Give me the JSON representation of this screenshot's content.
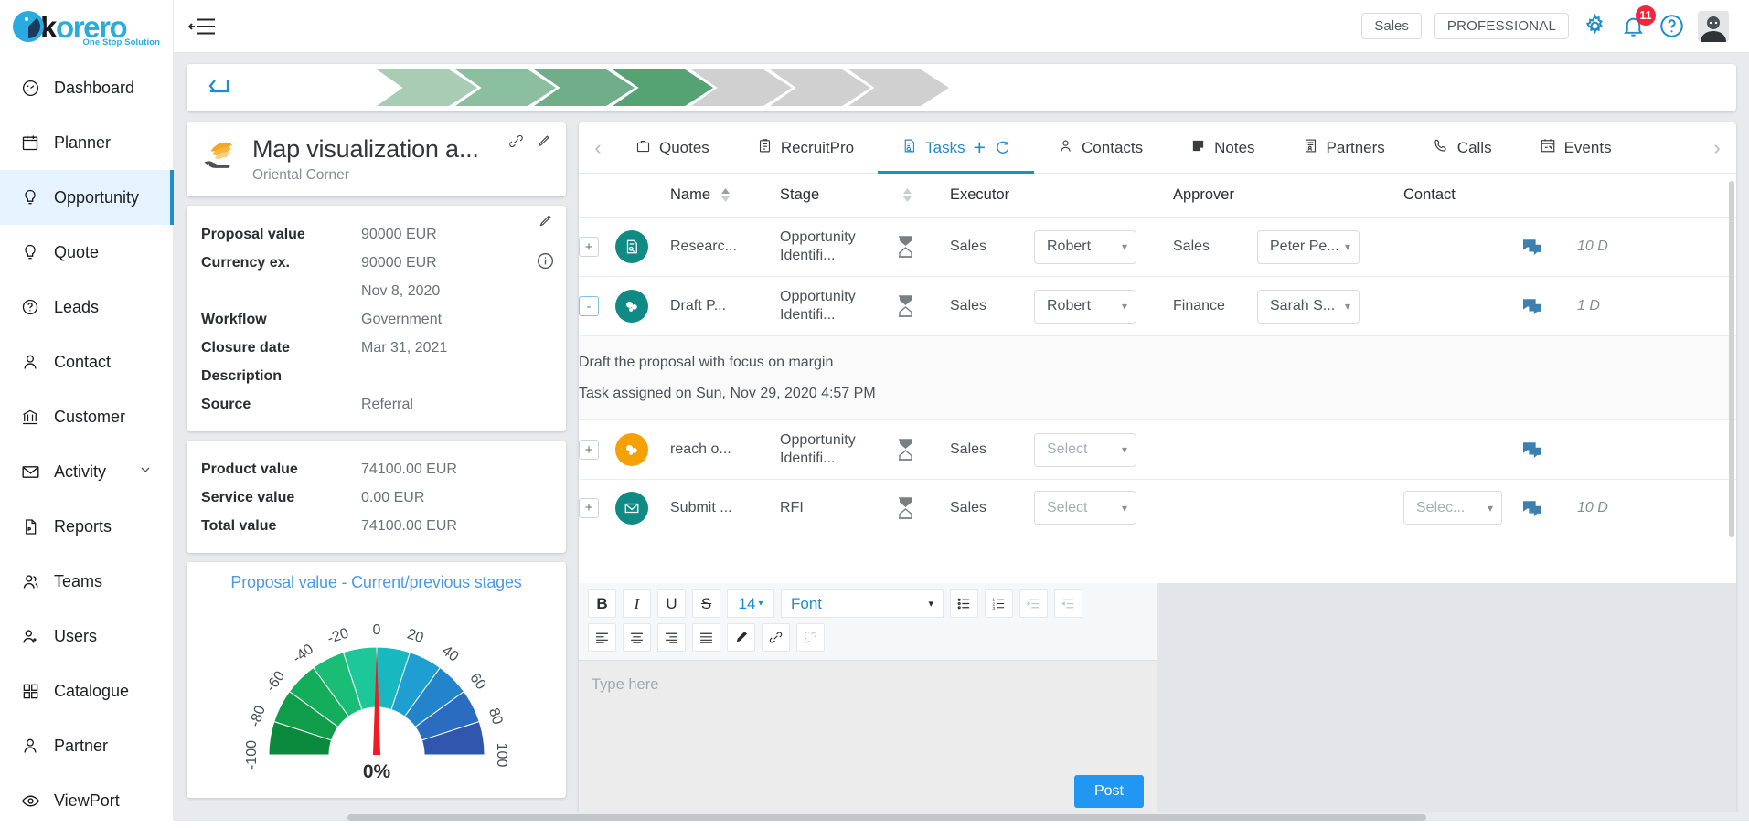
{
  "brand": {
    "name_k": "k",
    "name_rest": "orero",
    "tagline": "One Stop Solution",
    "logo_icon": "korero-logo-icon",
    "accent": "#29abe2"
  },
  "sidebar": {
    "items": [
      {
        "label": "Dashboard",
        "icon": "dashboard-icon",
        "active": false,
        "chevron": false
      },
      {
        "label": "Planner",
        "icon": "calendar-icon",
        "active": false,
        "chevron": false
      },
      {
        "label": "Opportunity",
        "icon": "bulb-icon",
        "active": true,
        "chevron": false
      },
      {
        "label": "Quote",
        "icon": "bulb-icon",
        "active": false,
        "chevron": false
      },
      {
        "label": "Leads",
        "icon": "question-circle-icon",
        "active": false,
        "chevron": false
      },
      {
        "label": "Contact",
        "icon": "user-icon",
        "active": false,
        "chevron": false
      },
      {
        "label": "Customer",
        "icon": "bank-icon",
        "active": false,
        "chevron": false
      },
      {
        "label": "Activity",
        "icon": "envelope-icon",
        "active": false,
        "chevron": true
      },
      {
        "label": "Reports",
        "icon": "pdf-file-icon",
        "active": false,
        "chevron": false
      },
      {
        "label": "Teams",
        "icon": "users-icon",
        "active": false,
        "chevron": false
      },
      {
        "label": "Users",
        "icon": "user-add-icon",
        "active": false,
        "chevron": false
      },
      {
        "label": "Catalogue",
        "icon": "grid-icon",
        "active": false,
        "chevron": false
      },
      {
        "label": "Partner",
        "icon": "user-icon",
        "active": false,
        "chevron": false
      },
      {
        "label": "ViewPort",
        "icon": "eye-icon",
        "active": false,
        "chevron": false
      }
    ]
  },
  "topbar": {
    "menu_icon": "collapse-menu-icon",
    "role_pill": "Sales",
    "plan_pill": "PROFESSIONAL",
    "settings_icon": "gear-icon",
    "notifications_icon": "bell-icon",
    "notifications_count": "11",
    "help_icon": "question-circle-icon",
    "avatar": "user-avatar",
    "badge_color": "#f4243c"
  },
  "stage_strip": {
    "back_icon": "back-arrow-icon",
    "stages": [
      {
        "state": "done",
        "color": "#a8cdb4"
      },
      {
        "state": "done",
        "color": "#8cbf9f"
      },
      {
        "state": "done",
        "color": "#6fae88"
      },
      {
        "state": "current",
        "color": "#55a273"
      },
      {
        "state": "todo",
        "color": "#d0d0d0"
      },
      {
        "state": "todo",
        "color": "#d0d0d0"
      },
      {
        "state": "todo",
        "color": "#d0d0d0"
      }
    ]
  },
  "opportunity": {
    "icon": "hand-money-icon",
    "title": "Map visualization a...",
    "subtitle": "Oriental Corner",
    "link_icon": "link-icon",
    "edit_icon": "pencil-icon",
    "details_edit_icon": "pencil-icon",
    "info_icon": "info-icon",
    "fields": [
      {
        "key": "Proposal value",
        "value": "90000 EUR"
      },
      {
        "key": "Currency ex.",
        "value": "90000 EUR"
      },
      {
        "key": "",
        "value": "Nov 8, 2020"
      },
      {
        "key": "Workflow",
        "value": "Government"
      },
      {
        "key": "Closure date",
        "value": "Mar 31, 2021"
      },
      {
        "key": "Description",
        "value": ""
      },
      {
        "key": "Source",
        "value": "Referral"
      }
    ],
    "value_fields": [
      {
        "key": "Product value",
        "value": "74100.00 EUR"
      },
      {
        "key": "Service value",
        "value": "0.00 EUR"
      },
      {
        "key": "Total value",
        "value": "74100.00 EUR"
      }
    ]
  },
  "chart_data": {
    "type": "gauge",
    "title": "Proposal value - Current/previous stages",
    "value": 0,
    "value_label": "0%",
    "min": -100,
    "max": 100,
    "ticks": [
      -100,
      -80,
      -60,
      -40,
      -20,
      0,
      20,
      40,
      60,
      80,
      100
    ],
    "needle_color": "#ee1c25",
    "band_colors": [
      "#0b8a3e",
      "#0f9d4a",
      "#14ad5c",
      "#1abd75",
      "#1dc79a",
      "#17b8bf",
      "#1f9fd1",
      "#2384cb",
      "#2a6cc0",
      "#3056ad"
    ],
    "xlabel": "",
    "ylabel": "",
    "grid": false,
    "legend": false
  },
  "tabs": {
    "prev_arrow": "chevron-left-icon",
    "next_arrow": "chevron-right-icon",
    "items": [
      {
        "label": "Quotes",
        "icon": "briefcase-icon",
        "active": false
      },
      {
        "label": "RecruitPro",
        "icon": "clipboard-icon",
        "active": false
      },
      {
        "label": "Tasks",
        "icon": "task-list-icon",
        "active": true
      },
      {
        "label": "Contacts",
        "icon": "user-icon",
        "active": false
      },
      {
        "label": "Notes",
        "icon": "note-icon",
        "active": false
      },
      {
        "label": "Partners",
        "icon": "partner-doc-icon",
        "active": false
      },
      {
        "label": "Calls",
        "icon": "phone-icon",
        "active": false
      },
      {
        "label": "Events",
        "icon": "calendar-check-icon",
        "active": false
      }
    ],
    "add_icon": "plus-icon",
    "refresh_icon": "refresh-icon"
  },
  "task_table": {
    "columns": [
      "",
      "",
      "Name",
      "Stage",
      "",
      "Executor",
      "",
      "Approver",
      "",
      "Contact",
      "",
      ""
    ],
    "headers": {
      "name": "Name",
      "stage": "Stage",
      "executor": "Executor",
      "approver": "Approver",
      "contact": "Contact"
    },
    "rows": [
      {
        "expander": "+",
        "expanded": false,
        "avatar_icon": "task-research-icon",
        "avatar_color": "#0f8a85",
        "name": "Researc...",
        "stage": "Opportunity Identifi...",
        "status_icon": "hourglass-icon",
        "executor_team": "Sales",
        "executor_user": "Robert",
        "approver_team": "Sales",
        "approver_user": "Peter Pe...",
        "chat_icon": "chat-icon",
        "days": "10 D"
      },
      {
        "expander": "-",
        "expanded": true,
        "avatar_icon": "task-draft-icon",
        "avatar_color": "#0f8a85",
        "name": "Draft P...",
        "stage": "Opportunity Identifi...",
        "status_icon": "hourglass-icon",
        "executor_team": "Sales",
        "executor_user": "Robert",
        "approver_team": "Finance",
        "approver_user": "Sarah S...",
        "chat_icon": "chat-icon",
        "days": "1 D",
        "detail_description": "Draft the proposal with focus on margin",
        "detail_assigned": "Task assigned on Sun, Nov 29, 2020 4:57 PM"
      },
      {
        "expander": "+",
        "expanded": false,
        "avatar_icon": "task-draft-icon",
        "avatar_color": "#f5a105",
        "name": "reach o...",
        "stage": "Opportunity Identifi...",
        "status_icon": "hourglass-icon",
        "executor_team": "Sales",
        "executor_user": "Select",
        "executor_empty": true,
        "approver_team": "",
        "approver_user": "",
        "chat_icon": "chat-icon",
        "days": ""
      },
      {
        "expander": "+",
        "expanded": false,
        "avatar_icon": "envelope-icon",
        "avatar_color": "#0f8a85",
        "name": "Submit ...",
        "stage": "RFI",
        "status_icon": "hourglass-icon",
        "executor_team": "Sales",
        "executor_user": "Select",
        "executor_empty": true,
        "approver_team": "",
        "approver_user": "Selec...",
        "approver_empty": true,
        "chat_icon": "chat-icon",
        "days": "10 D"
      }
    ]
  },
  "editor": {
    "bold": "B",
    "italic": "I",
    "underline": "U",
    "strike": "S",
    "font_size": "14",
    "font_name": "Font",
    "bullet_list_icon": "bullet-list-icon",
    "number_list_icon": "numbered-list-icon",
    "indent_icon": "indent-icon",
    "outdent_icon": "outdent-icon",
    "align_left_icon": "align-left-icon",
    "align_center_icon": "align-center-icon",
    "align_right_icon": "align-right-icon",
    "align_justify_icon": "align-justify-icon",
    "highlight_icon": "marker-pen-icon",
    "link_icon": "link-icon",
    "unlink_icon": "unlink-icon",
    "placeholder": "Type here",
    "post_label": "Post",
    "post_color": "#2196f3"
  }
}
